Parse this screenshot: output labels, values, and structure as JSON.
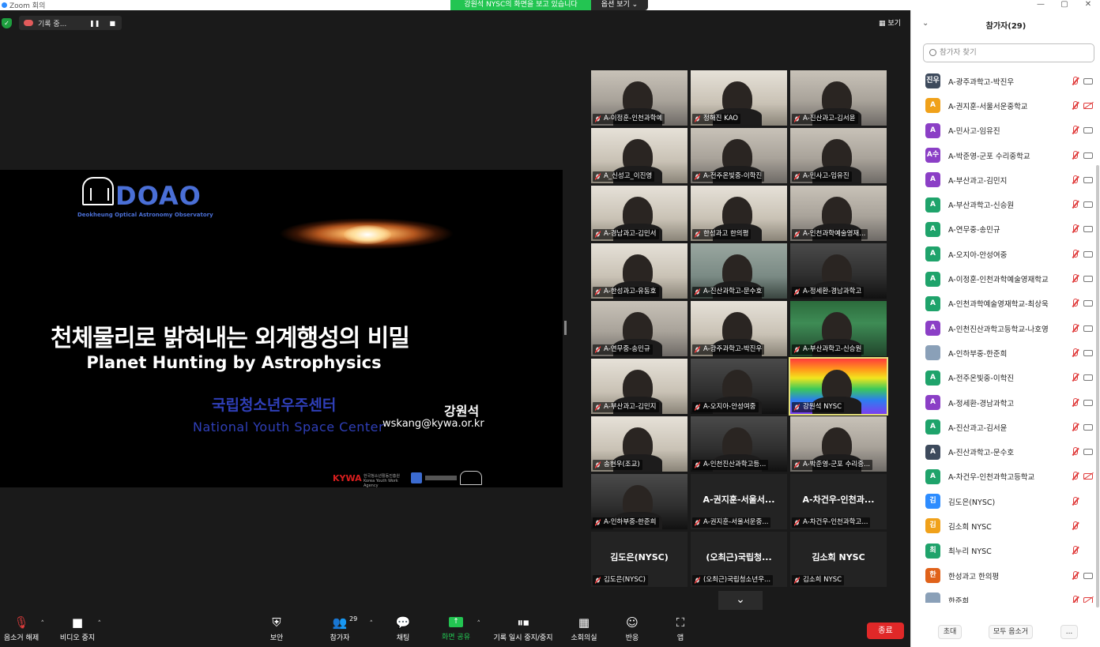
{
  "window": {
    "title": "Zoom 회의",
    "min": "—",
    "max": "▢",
    "close": "✕"
  },
  "share_banner": {
    "message": "강원석 NYSC의 화면을 보고 있습니다",
    "options": "옵션 보기 ⌄"
  },
  "meeting": {
    "recording_status": "기록 중...",
    "rec_pause": "❚❚",
    "rec_stop": "■",
    "view_label": "보기",
    "view_icon": "grid-icon"
  },
  "slide": {
    "logo_text": "DOAO",
    "logo_subtitle": "Deokheung Optical Astronomy Observatory",
    "title_ko": "천체물리로 밝혀내는 외계행성의 비밀",
    "title_en": "Planet Hunting by Astrophysics",
    "center_ko": "국립청소년우주센터",
    "center_en": "National Youth Space Center",
    "presenter_name": "강원석",
    "presenter_email": "wskang@kywa.or.kr",
    "footer_org": "KYWA",
    "footer_org_sub": "한국청소년활동진흥원 Korea Youth Work Agency"
  },
  "gallery": {
    "tiles": [
      {
        "label": "A-이정훈-인천과학예",
        "style": "photo"
      },
      {
        "label": "정해진 KAO",
        "style": "photo p2"
      },
      {
        "label": "A-진산과고-김서윤",
        "style": "photo"
      },
      {
        "label": "A_신성고_이진영",
        "style": "photo p2"
      },
      {
        "label": "A-전주온빛중-이학진",
        "style": "photo"
      },
      {
        "label": "A-민사고-임유진",
        "style": "photo"
      },
      {
        "label": "A-경남과고-김민서",
        "style": "photo p2"
      },
      {
        "label": "한성과고 한의평",
        "style": "photo p2"
      },
      {
        "label": "A-인천과학예술영재...",
        "style": "photo"
      },
      {
        "label": "A-한성과고-유동호",
        "style": "photo p2"
      },
      {
        "label": "A-진산과학고-문수호",
        "style": "photo p3"
      },
      {
        "label": "A-정세환-경남과학고",
        "style": "photo p4"
      },
      {
        "label": "A-연무중-송민규",
        "style": "photo"
      },
      {
        "label": "A-광주과학고-박진우",
        "style": "photo p2"
      },
      {
        "label": "A-부산과학고-신승원",
        "style": "photo p5"
      },
      {
        "label": "A-부산과고-김민지",
        "style": "photo p2"
      },
      {
        "label": "A-오지아-안성여중",
        "style": "photo p4"
      },
      {
        "label": "강원석 NYSC",
        "style": "rainbow"
      },
      {
        "label": "송현우(조교)",
        "style": "photo p2"
      },
      {
        "label": "A-인천진산과학고등...",
        "style": "photo p4"
      },
      {
        "label": "A-박준영-군포 수리중...",
        "style": "photo"
      },
      {
        "label": "A-인하부중-한준희",
        "style": "photo p4"
      },
      {
        "label": "A-권지훈-서울서운중...",
        "style": "dark",
        "bigname": "A-권지훈-서울서..."
      },
      {
        "label": "A-차건우-인천과학고...",
        "style": "dark",
        "bigname": "A-차건우-인천과..."
      },
      {
        "label": "김도은(NYSC)",
        "style": "dark",
        "bigname": "김도은(NYSC)"
      },
      {
        "label": "(오최근)국립청소년우...",
        "style": "dark",
        "bigname": "(오최근)국립청..."
      },
      {
        "label": "김소희 NYSC",
        "style": "dark",
        "bigname": "김소희 NYSC"
      }
    ],
    "page_down": "⌄"
  },
  "toolbar": {
    "unmute": "음소거 해제",
    "stop_video": "비디오 중지",
    "security": "보안",
    "participants": "참가자",
    "participants_count": "29",
    "chat": "채팅",
    "share_screen": "화면 공유",
    "pause_recording": "기록 일시 중지/중지",
    "breakout": "소회의실",
    "reactions": "반응",
    "apps": "앱",
    "end": "종료"
  },
  "panel": {
    "title": "참가자(29)",
    "collapse": "⌄",
    "search_placeholder": "참가자 찾기",
    "participants": [
      {
        "initial": "진우",
        "name": "A-광주과학고-박진우",
        "color": "#3d4a5c",
        "mic": true,
        "cam": "on"
      },
      {
        "initial": "A",
        "name": "A-권지훈-서울서운중학교",
        "color": "#f0a11a",
        "mic": true,
        "cam": "off"
      },
      {
        "initial": "A",
        "name": "A-민사고-임유진",
        "color": "#8b3fc6",
        "mic": true,
        "cam": "on"
      },
      {
        "initial": "A수",
        "name": "A-박준영-군포 수리중학교",
        "color": "#8b3fc6",
        "mic": true,
        "cam": "on"
      },
      {
        "initial": "A",
        "name": "A-부산과고-김민지",
        "color": "#8b3fc6",
        "mic": true,
        "cam": "on"
      },
      {
        "initial": "A",
        "name": "A-부산과학고-신승원",
        "color": "#1fa36b",
        "mic": true,
        "cam": "on"
      },
      {
        "initial": "A",
        "name": "A-연무중-송민규",
        "color": "#1fa36b",
        "mic": true,
        "cam": "on"
      },
      {
        "initial": "A",
        "name": "A-오지아-안성여중",
        "color": "#1fa36b",
        "mic": true,
        "cam": "on"
      },
      {
        "initial": "A",
        "name": "A-이정훈-인천과학예술영재학교",
        "color": "#1fa36b",
        "mic": true,
        "cam": "on"
      },
      {
        "initial": "A",
        "name": "A-인천과학예술영재학교-최상욱",
        "color": "#1fa36b",
        "mic": true,
        "cam": "on"
      },
      {
        "initial": "A",
        "name": "A-인천진산과학고등학교-나호영",
        "color": "#8b3fc6",
        "mic": true,
        "cam": "on"
      },
      {
        "initial": "",
        "name": "A-인하부중-한준희",
        "color": "#8aa0b8",
        "mic": true,
        "cam": "on"
      },
      {
        "initial": "A",
        "name": "A-전주온빛중-이학진",
        "color": "#1fa36b",
        "mic": true,
        "cam": "on"
      },
      {
        "initial": "A",
        "name": "A-정세환-경남과학고",
        "color": "#8b3fc6",
        "mic": true,
        "cam": "on"
      },
      {
        "initial": "A",
        "name": "A-진산과고-김서윤",
        "color": "#1fa36b",
        "mic": true,
        "cam": "on"
      },
      {
        "initial": "A",
        "name": "A-진산과학고-문수호",
        "color": "#3d4a5c",
        "mic": true,
        "cam": "on"
      },
      {
        "initial": "A",
        "name": "A-차건우-인천과학고등학교",
        "color": "#1fa36b",
        "mic": true,
        "cam": "off"
      },
      {
        "initial": "김",
        "name": "김도은(NYSC)",
        "color": "#2d8cff",
        "mic": true,
        "cam": "none"
      },
      {
        "initial": "김",
        "name": "김소희 NYSC",
        "color": "#f0a11a",
        "mic": true,
        "cam": "none"
      },
      {
        "initial": "최",
        "name": "최누리 NYSC",
        "color": "#1fa36b",
        "mic": true,
        "cam": "none"
      },
      {
        "initial": "한",
        "name": "한성과고 한의평",
        "color": "#e0621a",
        "mic": true,
        "cam": "on"
      },
      {
        "initial": "",
        "name": "한준희",
        "color": "#8aa0b8",
        "mic": true,
        "cam": "off"
      }
    ],
    "invite": "초대",
    "mute_all": "모두 음소거",
    "more": "..."
  }
}
